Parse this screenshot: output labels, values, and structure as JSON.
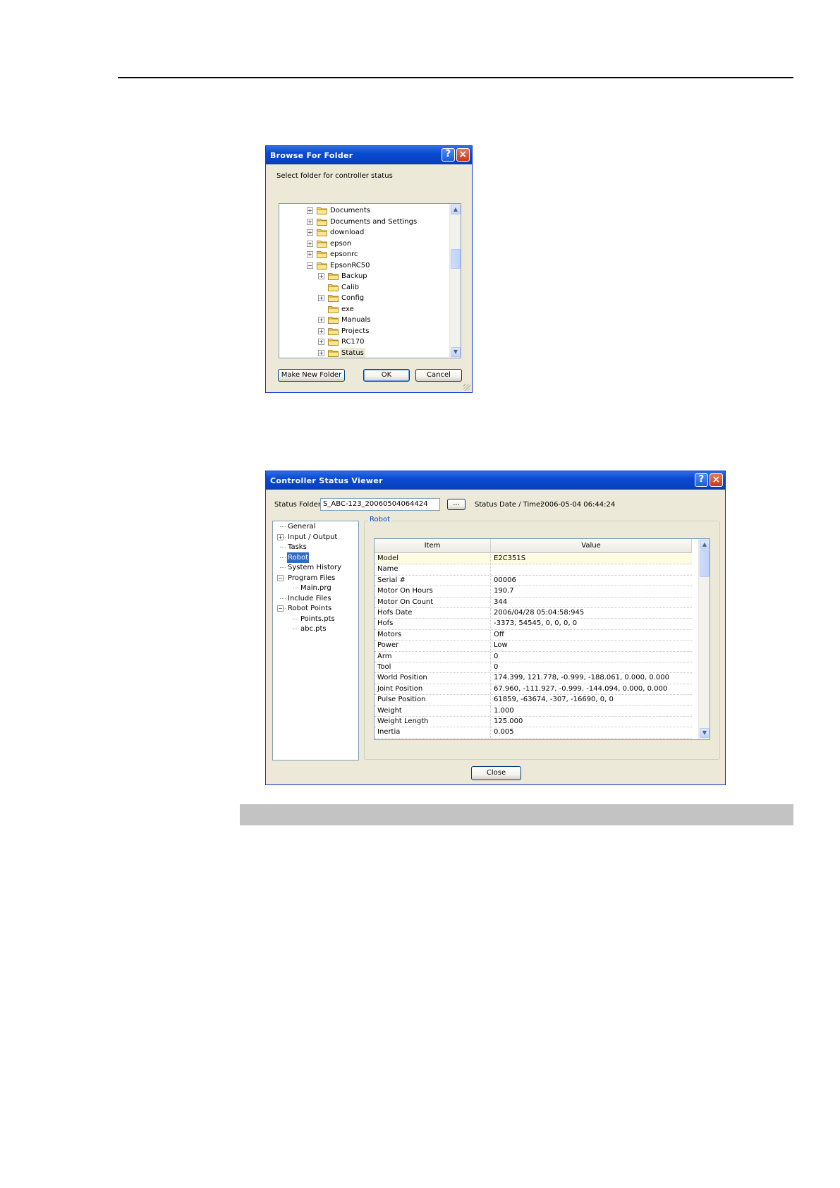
{
  "browse_dialog": {
    "title": "Browse For Folder",
    "help_label": "?",
    "close_label": "×",
    "prompt": "Select folder for controller status",
    "tree": [
      {
        "label": "Documents",
        "level": 0,
        "expander": "+"
      },
      {
        "label": "Documents and Settings",
        "level": 0,
        "expander": "+"
      },
      {
        "label": "download",
        "level": 0,
        "expander": "+"
      },
      {
        "label": "epson",
        "level": 0,
        "expander": "+"
      },
      {
        "label": "epsonrc",
        "level": 0,
        "expander": "+"
      },
      {
        "label": "EpsonRC50",
        "level": 0,
        "expander": "−"
      },
      {
        "label": "Backup",
        "level": 1,
        "expander": "+"
      },
      {
        "label": "Calib",
        "level": 1,
        "expander": ""
      },
      {
        "label": "Config",
        "level": 1,
        "expander": "+"
      },
      {
        "label": "exe",
        "level": 1,
        "expander": ""
      },
      {
        "label": "Manuals",
        "level": 1,
        "expander": "+"
      },
      {
        "label": "Projects",
        "level": 1,
        "expander": "+"
      },
      {
        "label": "RC170",
        "level": 1,
        "expander": "+"
      },
      {
        "label": "Status",
        "level": 1,
        "expander": "+",
        "selected": true
      }
    ],
    "buttons": {
      "make_new_folder": "Make New Folder",
      "ok": "OK",
      "cancel": "Cancel"
    }
  },
  "viewer_dialog": {
    "title": "Controller Status Viewer",
    "help_label": "?",
    "close_label": "×",
    "status_folder_label": "Status Folder",
    "status_folder_value": "S_ABC-123_20060504064424",
    "browse_label": "...",
    "status_date_label": "Status Date / Time:",
    "status_date_value": "2006-05-04 06:44:24",
    "tree": [
      {
        "label": "General",
        "expander": "",
        "indent": 0
      },
      {
        "label": "Input / Output",
        "expander": "+",
        "indent": 0
      },
      {
        "label": "Tasks",
        "expander": "",
        "indent": 0
      },
      {
        "label": "Robot",
        "expander": "",
        "indent": 0,
        "selected": true
      },
      {
        "label": "System History",
        "expander": "",
        "indent": 0
      },
      {
        "label": "Program Files",
        "expander": "−",
        "indent": 0
      },
      {
        "label": "Main.prg",
        "expander": "",
        "indent": 1
      },
      {
        "label": "Include Files",
        "expander": "",
        "indent": 0
      },
      {
        "label": "Robot Points",
        "expander": "−",
        "indent": 0
      },
      {
        "label": "Points.pts",
        "expander": "",
        "indent": 1
      },
      {
        "label": "abc.pts",
        "expander": "",
        "indent": 1
      }
    ],
    "group_label": "Robot",
    "grid_headers": {
      "item": "Item",
      "value": "Value"
    },
    "grid_rows": [
      {
        "item": "Model",
        "value": "E2C351S"
      },
      {
        "item": "Name",
        "value": ""
      },
      {
        "item": "Serial #",
        "value": "00006"
      },
      {
        "item": "Motor On Hours",
        "value": "190.7"
      },
      {
        "item": "Motor On Count",
        "value": "344"
      },
      {
        "item": "Hofs Date",
        "value": "2006/04/28 05:04:58:945"
      },
      {
        "item": "Hofs",
        "value": "-3373, 54545, 0, 0, 0, 0"
      },
      {
        "item": "Motors",
        "value": "Off"
      },
      {
        "item": "Power",
        "value": "Low"
      },
      {
        "item": "Arm",
        "value": "0"
      },
      {
        "item": "Tool",
        "value": "0"
      },
      {
        "item": "World Position",
        "value": "174.399, 121.778, -0.999, -188.061, 0.000, 0.000"
      },
      {
        "item": "Joint Position",
        "value": "67.960, -111.927, -0.999, -144.094, 0.000, 0.000"
      },
      {
        "item": "Pulse Position",
        "value": "61859, -63674, -307, -16690, 0, 0"
      },
      {
        "item": "Weight",
        "value": "1.000"
      },
      {
        "item": "Weight Length",
        "value": "125.000"
      },
      {
        "item": "Inertia",
        "value": "0.005"
      }
    ],
    "close_button": "Close"
  },
  "colors": {
    "titlebar": "#0a4ad2",
    "dialog_bg": "#ece9d8",
    "selection": "#316ac5",
    "group_label": "#0046d5"
  }
}
